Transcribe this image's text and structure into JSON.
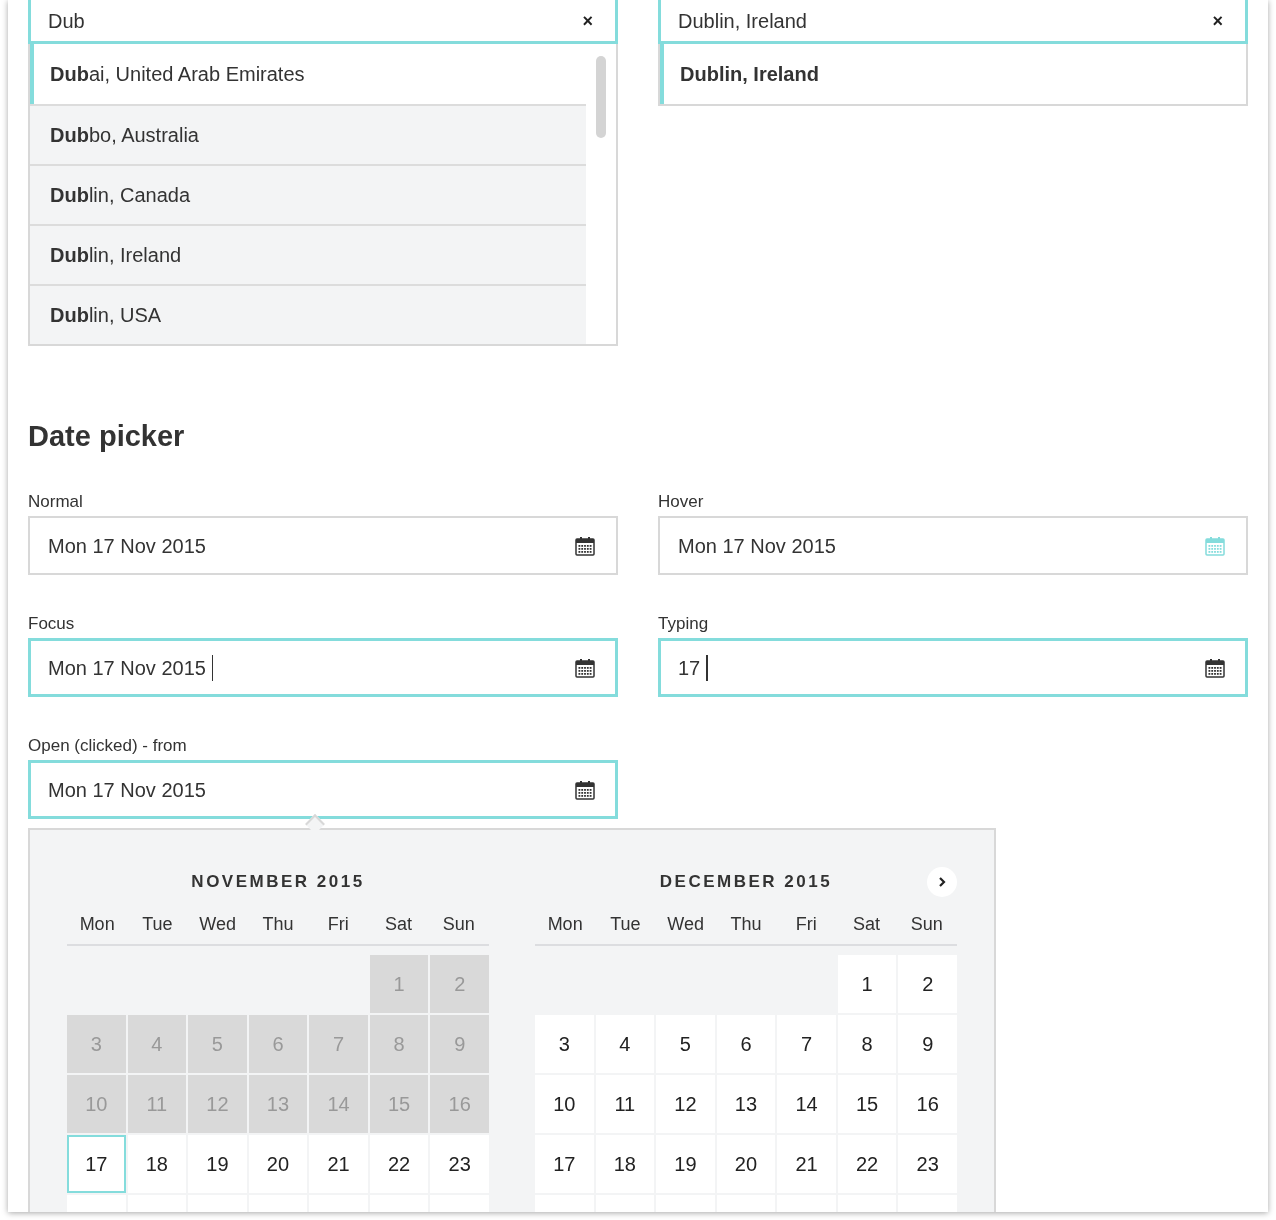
{
  "autocomplete": [
    {
      "value": "Dub",
      "clear_label": "×",
      "options": [
        {
          "label": "**Dub**ai, United Arab Emirates",
          "kind": "partial",
          "selected": true
        },
        {
          "label": "**Dub**bo, Australia",
          "kind": "partial",
          "selected": false
        },
        {
          "label": "**Dub**lin, Canada",
          "kind": "partial",
          "selected": false
        },
        {
          "label": "**Dub**lin, Ireland",
          "kind": "partial",
          "selected": false
        },
        {
          "label": "**Dub**lin, USA",
          "kind": "partial",
          "selected": false
        }
      ]
    },
    {
      "value": "Dublin, Ireland",
      "clear_label": "×",
      "options": [
        {
          "label": "Dublin, Ireland",
          "kind": "exact",
          "selected": true
        }
      ]
    }
  ],
  "section_title": "Date picker",
  "date_fields": [
    {
      "label": "Normal",
      "value": "Mon 17 Nov 2015",
      "hovered": false,
      "focused": false,
      "caret": false
    },
    {
      "label": "Hover",
      "value": "Mon 17 Nov 2015",
      "hovered": true,
      "focused": false,
      "caret": false
    },
    {
      "label": "Focus",
      "value": "Mon 17 Nov 2015",
      "hovered": false,
      "focused": true,
      "caret": true
    },
    {
      "label": "Typing",
      "value": "17",
      "hovered": false,
      "focused": true,
      "caret": true
    },
    {
      "label": "Open (clicked) - from",
      "value": "Mon 17 Nov 2015",
      "hovered": false,
      "focused": true,
      "caret": false
    }
  ],
  "calendar": {
    "months": [
      {
        "title": "NOVEMBER 2015",
        "weekdays": [
          "Mon",
          "Tue",
          "Wed",
          "Thu",
          "Fri",
          "Sat",
          "Sun"
        ],
        "weeks": [
          [
            {
              "day": "1",
              "disabled": true,
              "selected": false
            },
            {
              "day": "2",
              "disabled": true,
              "selected": false
            }
          ],
          [
            {
              "day": "3",
              "disabled": true,
              "selected": false
            },
            {
              "day": "4",
              "disabled": true,
              "selected": false
            },
            {
              "day": "5",
              "disabled": true,
              "selected": false
            },
            {
              "day": "6",
              "disabled": true,
              "selected": false
            },
            {
              "day": "7",
              "disabled": true,
              "selected": false
            },
            {
              "day": "8",
              "disabled": true,
              "selected": false
            },
            {
              "day": "9",
              "disabled": true,
              "selected": false
            }
          ],
          [
            {
              "day": "10",
              "disabled": true,
              "selected": false
            },
            {
              "day": "11",
              "disabled": true,
              "selected": false
            },
            {
              "day": "12",
              "disabled": true,
              "selected": false
            },
            {
              "day": "13",
              "disabled": true,
              "selected": false
            },
            {
              "day": "14",
              "disabled": true,
              "selected": false
            },
            {
              "day": "15",
              "disabled": true,
              "selected": false
            },
            {
              "day": "16",
              "disabled": true,
              "selected": false
            }
          ],
          [
            {
              "day": "17",
              "disabled": false,
              "selected": true
            },
            {
              "day": "18",
              "disabled": false,
              "selected": false
            },
            {
              "day": "19",
              "disabled": false,
              "selected": false
            },
            {
              "day": "20",
              "disabled": false,
              "selected": false
            },
            {
              "day": "21",
              "disabled": false,
              "selected": false
            },
            {
              "day": "22",
              "disabled": false,
              "selected": false
            },
            {
              "day": "23",
              "disabled": false,
              "selected": false
            }
          ]
        ]
      },
      {
        "title": "DECEMBER 2015",
        "weekdays": [
          "Mon",
          "Tue",
          "Wed",
          "Thu",
          "Fri",
          "Sat",
          "Sun"
        ],
        "weeks": [
          [
            {
              "day": "1",
              "disabled": false,
              "selected": false
            },
            {
              "day": "2",
              "disabled": false,
              "selected": false
            }
          ],
          [
            {
              "day": "3",
              "disabled": false,
              "selected": false
            },
            {
              "day": "4",
              "disabled": false,
              "selected": false
            },
            {
              "day": "5",
              "disabled": false,
              "selected": false
            },
            {
              "day": "6",
              "disabled": false,
              "selected": false
            },
            {
              "day": "7",
              "disabled": false,
              "selected": false
            },
            {
              "day": "8",
              "disabled": false,
              "selected": false
            },
            {
              "day": "9",
              "disabled": false,
              "selected": false
            }
          ],
          [
            {
              "day": "10",
              "disabled": false,
              "selected": false
            },
            {
              "day": "11",
              "disabled": false,
              "selected": false
            },
            {
              "day": "12",
              "disabled": false,
              "selected": false
            },
            {
              "day": "13",
              "disabled": false,
              "selected": false
            },
            {
              "day": "14",
              "disabled": false,
              "selected": false
            },
            {
              "day": "15",
              "disabled": false,
              "selected": false
            },
            {
              "day": "16",
              "disabled": false,
              "selected": false
            }
          ],
          [
            {
              "day": "17",
              "disabled": false,
              "selected": false
            },
            {
              "day": "18",
              "disabled": false,
              "selected": false
            },
            {
              "day": "19",
              "disabled": false,
              "selected": false
            },
            {
              "day": "20",
              "disabled": false,
              "selected": false
            },
            {
              "day": "21",
              "disabled": false,
              "selected": false
            },
            {
              "day": "22",
              "disabled": false,
              "selected": false
            },
            {
              "day": "23",
              "disabled": false,
              "selected": false
            }
          ]
        ]
      }
    ]
  }
}
